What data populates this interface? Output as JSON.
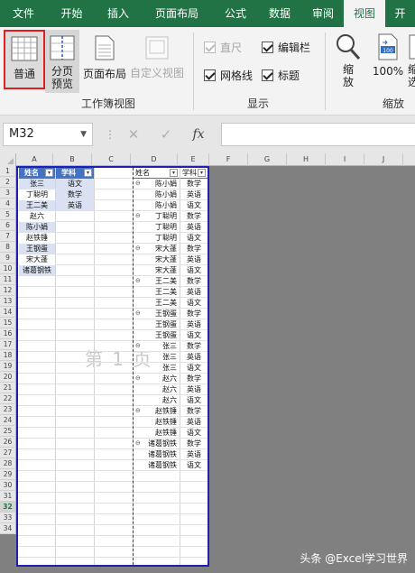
{
  "ribbon_tabs": [
    "文件",
    "开始",
    "插入",
    "页面布局",
    "公式",
    "数据",
    "审阅",
    "视图",
    "开"
  ],
  "active_tab": "视图",
  "ribbon": {
    "normal": "普通",
    "page_break_line1": "分页",
    "page_break_line2": "预览",
    "page_layout": "页面布局",
    "custom_view": "自定义视图",
    "group_workbook_views": "工作簿视图",
    "ruler": "直尺",
    "formula_bar": "编辑栏",
    "gridlines": "网格线",
    "headings": "标题",
    "group_show": "显示",
    "zoom_line1": "缩",
    "zoom_line2": "放",
    "zoom100": "100%",
    "zoom_sel_line1": "缩",
    "zoom_sel_line2": "选",
    "group_zoom": "缩放",
    "ruler_checked": true,
    "formula_bar_checked": true,
    "gridlines_checked": true,
    "headings_checked": true
  },
  "formula_bar": {
    "name_box": "M32",
    "cancel": "✕",
    "enter": "✓",
    "fx": "fx"
  },
  "sheet": {
    "columns": [
      "A",
      "B",
      "C",
      "D",
      "E",
      "F",
      "G",
      "H",
      "I",
      "J"
    ],
    "rows": [
      "1",
      "2",
      "3",
      "4",
      "5",
      "6",
      "7",
      "8",
      "9",
      "10",
      "11",
      "12",
      "13",
      "14",
      "15",
      "16",
      "17",
      "18",
      "19",
      "20",
      "21",
      "22",
      "23",
      "24",
      "25",
      "26",
      "27",
      "28",
      "29",
      "30",
      "31",
      "32",
      "33",
      "34"
    ],
    "selected_row": "32",
    "watermark": "第 1 页",
    "table1": {
      "header_name": "姓名",
      "names": [
        "张三",
        "丁聪明",
        "王二美",
        "赵六",
        "陈小娟",
        "赵铁锤",
        "王钢蛋",
        "宋大蓬",
        "诸葛钢铁"
      ]
    },
    "table2": {
      "header_subject": "学科",
      "subjects": [
        "语文",
        "数学",
        "英语"
      ]
    },
    "table3": {
      "header_name": "姓名",
      "header_subject": "学科",
      "rows": [
        [
          "陈小娟",
          "数学"
        ],
        [
          "陈小娟",
          "英语"
        ],
        [
          "陈小娟",
          "语文"
        ],
        [
          "丁聪明",
          "数学"
        ],
        [
          "丁聪明",
          "英语"
        ],
        [
          "丁聪明",
          "语文"
        ],
        [
          "宋大蓬",
          "数学"
        ],
        [
          "宋大蓬",
          "英语"
        ],
        [
          "宋大蓬",
          "语文"
        ],
        [
          "王二美",
          "数学"
        ],
        [
          "王二美",
          "英语"
        ],
        [
          "王二美",
          "语文"
        ],
        [
          "王钢蛋",
          "数学"
        ],
        [
          "王钢蛋",
          "英语"
        ],
        [
          "王钢蛋",
          "语文"
        ],
        [
          "张三",
          "数学"
        ],
        [
          "张三",
          "英语"
        ],
        [
          "张三",
          "语文"
        ],
        [
          "赵六",
          "数学"
        ],
        [
          "赵六",
          "英语"
        ],
        [
          "赵六",
          "语文"
        ],
        [
          "赵铁锤",
          "数学"
        ],
        [
          "赵铁锤",
          "英语"
        ],
        [
          "赵铁锤",
          "语文"
        ],
        [
          "诸葛钢铁",
          "数学"
        ],
        [
          "诸葛钢铁",
          "英语"
        ],
        [
          "诸葛钢铁",
          "语文"
        ]
      ]
    }
  },
  "credit": "头条 @Excel学习世界",
  "colors": {
    "ribbon_green": "#217346",
    "table_header_blue": "#4472c4",
    "table_band": "#d9e1f2",
    "page_border": "#1f1fb3",
    "highlight_red": "#e02020"
  }
}
